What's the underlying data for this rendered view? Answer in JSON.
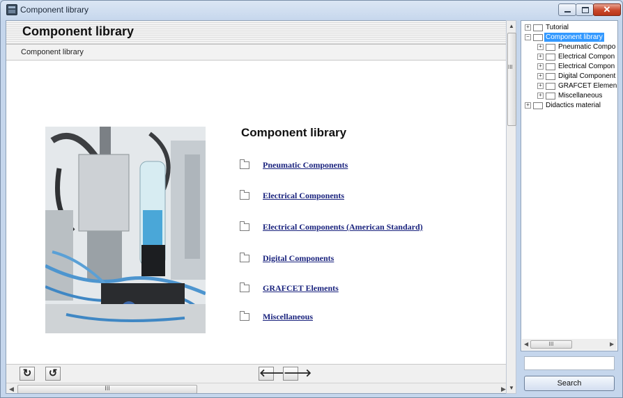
{
  "window": {
    "title": "Component library"
  },
  "header": {
    "title": "Component library",
    "breadcrumb": "Component library"
  },
  "main": {
    "heading": "Component library",
    "links": [
      "Pneumatic Components",
      "Electrical Components",
      "Electrical Components (American Standard)",
      "Digital Components",
      "GRAFCET Elements",
      "Miscellaneous"
    ]
  },
  "nav": {
    "back_glyph": "🡐",
    "forward_glyph": "🡒",
    "reload_glyph": "↻",
    "refresh_glyph": "↺"
  },
  "scrollbar": {
    "grip": "III"
  },
  "tree": {
    "items": [
      {
        "label": "Tutorial",
        "expander": "+"
      },
      {
        "label": "Component library",
        "expander": "−",
        "selected": true
      },
      {
        "label": "Pneumatic Compo",
        "expander": "+"
      },
      {
        "label": "Electrical Compon",
        "expander": "+"
      },
      {
        "label": "Electrical Compon",
        "expander": "+"
      },
      {
        "label": "Digital Component",
        "expander": "+"
      },
      {
        "label": "GRAFCET Elemen",
        "expander": "+"
      },
      {
        "label": "Miscellaneous",
        "expander": "+"
      },
      {
        "label": "Didactics material",
        "expander": "+"
      }
    ]
  },
  "search": {
    "button_label": "Search",
    "value": ""
  },
  "colors": {
    "link": "#1a237e",
    "selection": "#3399ff",
    "close_button": "#c9472a"
  }
}
